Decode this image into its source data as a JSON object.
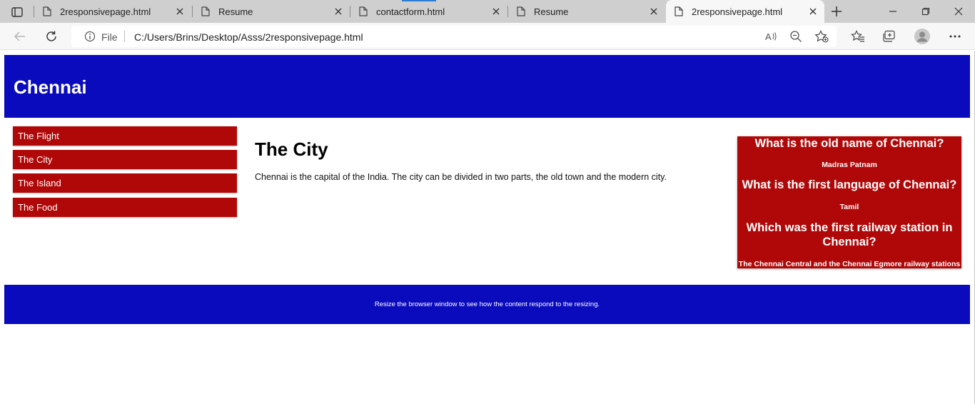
{
  "browser": {
    "tabs": [
      {
        "title": "2responsivepage.html",
        "active": false
      },
      {
        "title": "Resume",
        "active": false
      },
      {
        "title": "contactform.html",
        "active": false
      },
      {
        "title": "Resume",
        "active": false
      },
      {
        "title": "2responsivepage.html",
        "active": true
      }
    ],
    "address": {
      "scheme_label": "File",
      "url": "C:/Users/Brins/Desktop/Asss/2responsivepage.html"
    },
    "icons": {
      "tab_actions": "tab-actions-icon",
      "page": "page-icon",
      "close": "close-icon",
      "new_tab": "plus-icon",
      "back": "back-arrow-icon",
      "refresh": "refresh-icon",
      "info": "info-icon",
      "read_aloud": "read-aloud-icon",
      "zoom": "zoom-out-icon",
      "add_favorite": "add-favorite-icon",
      "favorites": "favorites-icon",
      "collections": "collections-icon",
      "profile": "profile-avatar-icon",
      "more": "more-icon"
    }
  },
  "page": {
    "header": {
      "title": "Chennai"
    },
    "menu": [
      {
        "label": "The Flight"
      },
      {
        "label": "The City"
      },
      {
        "label": "The Island"
      },
      {
        "label": "The Food"
      }
    ],
    "main": {
      "title": "The City",
      "text": "Chennai is the capital of the India. The city can be divided in two parts, the old town and the modern city."
    },
    "aside": {
      "items": [
        {
          "question": "What is the old name of Chennai?",
          "answer": "Madras Patnam"
        },
        {
          "question": "What is the first language of Chennai?",
          "answer": "Tamil"
        },
        {
          "question": "Which was the first railway station in Chennai?",
          "answer": "The Chennai Central and the Chennai Egmore railway stations"
        }
      ]
    },
    "footer": {
      "text": "Resize the browser window to see how the content respond to the resizing."
    },
    "colors": {
      "header_bg": "#0a0bbd",
      "menu_bg": "#b00808",
      "aside_bg": "#b00808",
      "footer_bg": "#0a0bbd"
    }
  }
}
